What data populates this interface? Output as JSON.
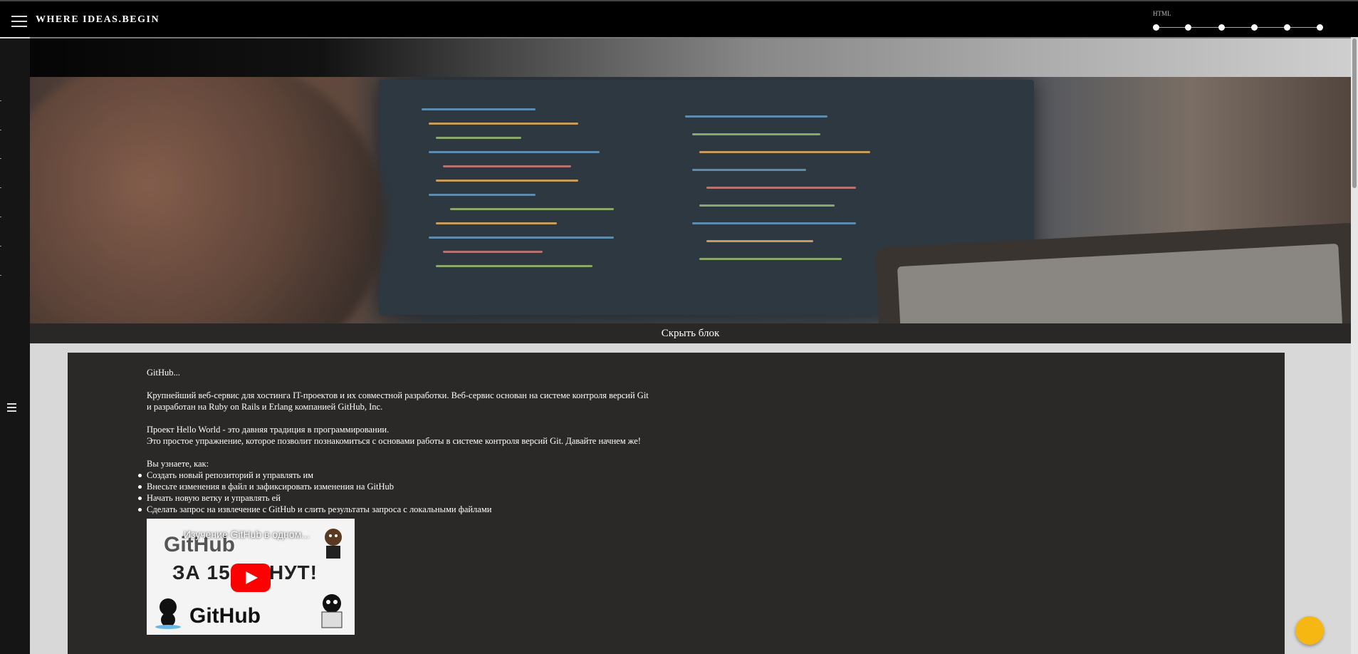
{
  "header": {
    "brand": "WHERE IDEAS.BEGIN",
    "progress_label": "HTML",
    "progress_steps": 6
  },
  "hero": {
    "hide_label": "Скрыть блок"
  },
  "content": {
    "intro": "GitHub...",
    "paragraph1_line1": "Крупнейший веб-сервис для хостинга IT-проектов и их совместной разработки. Веб-сервис основан на системе контроля версий Git",
    "paragraph1_line2": "и разработан на Ruby on Rails и Erlang компанией GitHub, Inc.",
    "paragraph2_line1": "Проект Hello World - это давняя традиция в программировании.",
    "paragraph2_line2": "Это простое упражнение, которое позволит познакомиться с основами работы в системе контроля версий Git. Давайте начнем же!",
    "list_heading": "Вы узнаете, как:",
    "items": [
      "Создать новый репозиторий и управлять им",
      "Внесьте изменения в файл и зафиксировать изменения на GitHub",
      "Начать новую ветку и управлять ей",
      "Сделать запрос на извлечение с GitHub и слить результаты запроса с локальными файлами"
    ]
  },
  "video": {
    "title": "Изучение GitHub в одном...",
    "thumb_big": "GitHub",
    "thumb_sub": "ЗА 15 МИНУТ!",
    "thumb_brand": "GitHub"
  },
  "colors": {
    "accent": "#f7b712",
    "topbar": "#000000",
    "content_bg": "#2b2828",
    "page_bg": "#d8d8d8"
  },
  "icons": {
    "menu": "hamburger-icon",
    "side_menu": "menu-icon",
    "play": "play-icon",
    "fab": "circle-button"
  }
}
